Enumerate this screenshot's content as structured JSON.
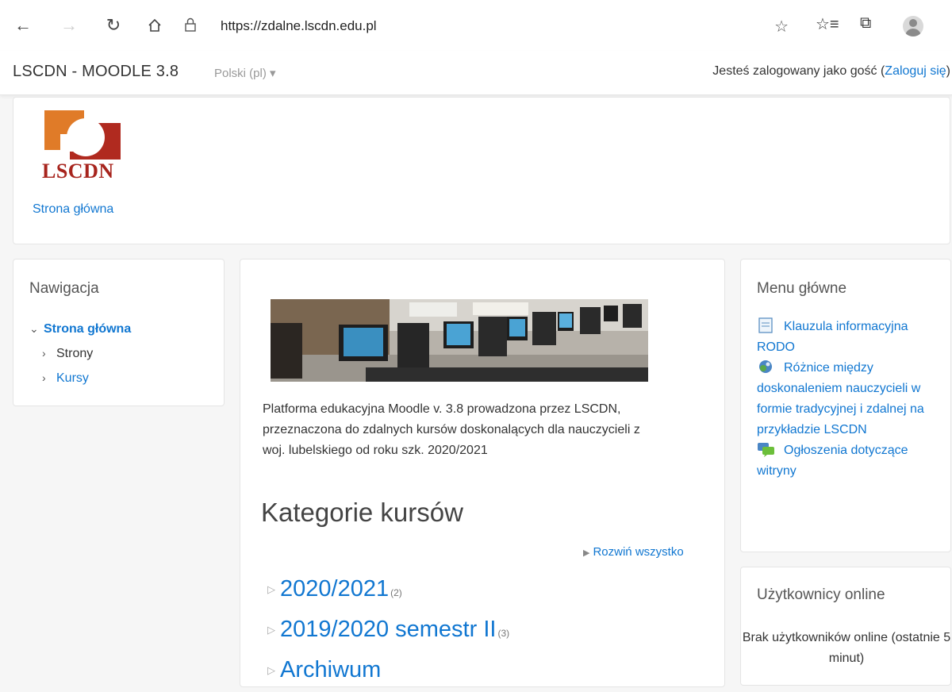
{
  "browser": {
    "url": "https://zdalne.lscdn.edu.pl",
    "icons": [
      "back-arrow-icon",
      "forward-arrow-icon",
      "reload-icon",
      "home-icon",
      "lock-icon",
      "star-icon",
      "favorites-icon",
      "collections-icon",
      "profile-icon"
    ]
  },
  "navbar": {
    "site_name": "LSCDN - MOODLE 3.8",
    "language": "Polski (pl)",
    "login_prefix": "Jesteś zalogowany jako gość (",
    "login_link": "Zaloguj się",
    "login_suffix": ")"
  },
  "header": {
    "logo_text": "LSCDN",
    "breadcrumb": "Strona główna",
    "logo_colors": {
      "orange": "#e07b28",
      "red": "#b02a1f"
    }
  },
  "navigation": {
    "title": "Nawigacja",
    "root": "Strona główna",
    "items": [
      "Strony",
      "Kursy"
    ]
  },
  "main": {
    "description": "Platforma edukacyjna Moodle v. 3.8 prowadzona przez LSCDN, przeznaczona do zdalnych kursów doskonalących dla nauczycieli z woj. lubelskiego od roku szk. 2020/2021",
    "categories_heading": "Kategorie kursów",
    "expand_all": "Rozwiń wszystko",
    "categories": [
      {
        "name": "2020/2021",
        "count": "(2)"
      },
      {
        "name": "2019/2020 semestr II",
        "count": "(3)"
      },
      {
        "name": "Archiwum",
        "count": ""
      }
    ]
  },
  "main_menu": {
    "title": "Menu główne",
    "items": [
      {
        "label": "Klauzula informacyjna RODO",
        "icon": "page-icon"
      },
      {
        "label": "Różnice między doskonaleniem nauczycieli w formie tradycyjnej i zdalnej na przykładzie LSCDN",
        "icon": "url-globe-icon"
      },
      {
        "label": "Ogłoszenia dotyczące witryny",
        "icon": "forum-icon"
      }
    ]
  },
  "online_users": {
    "title": "Użytkownicy online",
    "text": "Brak użytkowników online (ostatnie 5 minut)"
  },
  "colors": {
    "link": "#1177d1",
    "brand_red": "#a7241d"
  }
}
